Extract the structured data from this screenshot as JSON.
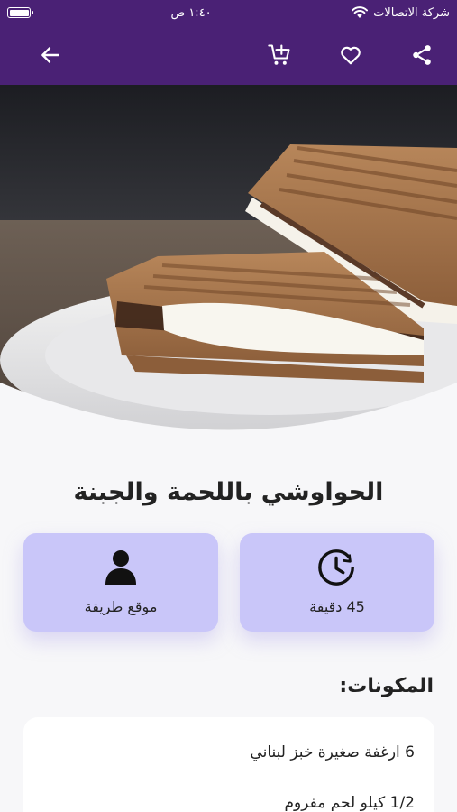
{
  "status_bar": {
    "carrier": "شركة الاتصالات",
    "time": "١:٤٠ ص"
  },
  "app_bar": {
    "icons": [
      "share-icon",
      "heart-icon",
      "add-to-cart-icon",
      "back-arrow-icon"
    ]
  },
  "recipe": {
    "title": "الحواوشي باللحمة والجبنة",
    "info_cards": [
      {
        "icon": "clock-icon",
        "label": "45 دقيقة"
      },
      {
        "icon": "user-icon",
        "label": "موقع طريقة"
      }
    ],
    "ingredients_heading": "المكونات:",
    "ingredients": [
      "6 ارغفة صغيرة خبز لبناني",
      "1/2 كيلو لحم مفروم"
    ]
  },
  "colors": {
    "header_bg": "#4a2175",
    "card_bg": "#c9c6f9",
    "page_bg": "#f7f7f9"
  }
}
